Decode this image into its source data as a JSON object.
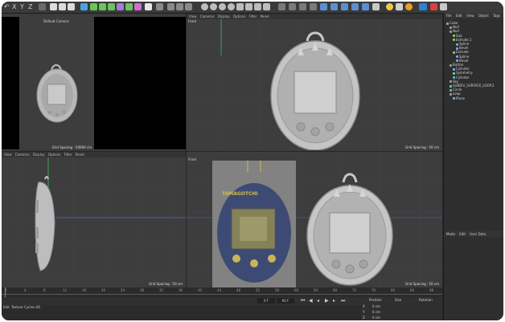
{
  "toolbar": {
    "menu_glyphs": [
      "X",
      "Y",
      "Z"
    ],
    "accent_color": "#e8a21d"
  },
  "viewports": {
    "top_left": {
      "name": "Default Camera",
      "grid": "Grid Spacing : 50000 cm"
    },
    "top_right": {
      "name": "Front",
      "grid": "Grid Spacing : 50 cm",
      "menu": [
        "View",
        "Cameras",
        "Display",
        "Options",
        "Filter",
        "Panel"
      ]
    },
    "bottom_left": {
      "name": "",
      "grid": "Grid Spacing : 50 cm",
      "menu": [
        "View",
        "Cameras",
        "Display",
        "Options",
        "Filter",
        "Panel"
      ]
    },
    "bottom_right": {
      "name": "Front",
      "grid": "Grid Spacing : 50 cm"
    }
  },
  "reference_image": {
    "brand_text": "TAMAGOTCHI"
  },
  "timeline": {
    "ticks": [
      "0",
      "4",
      "8",
      "12",
      "16",
      "20",
      "24",
      "28",
      "32",
      "36",
      "40",
      "44",
      "48",
      "52",
      "56",
      "60",
      "64",
      "68",
      "72",
      "76",
      "80",
      "84",
      "88"
    ],
    "current_frame": "0 F",
    "end_frame": "90 F"
  },
  "bottom_tabs": [
    "Edit",
    "Texture",
    "Cycles 4D"
  ],
  "object_manager": {
    "menu": [
      "File",
      "Edit",
      "View",
      "Object",
      "Tags"
    ],
    "rows": [
      {
        "label": "Cube",
        "indent": 0,
        "icon_color": "#5fb4e8"
      },
      {
        "label": "Null",
        "indent": 1,
        "icon_color": "#9a9a9a"
      },
      {
        "label": "Null",
        "indent": 1,
        "icon_color": "#9a9a9a"
      },
      {
        "label": "Sub",
        "indent": 2,
        "icon_color": "#7bd36b"
      },
      {
        "label": "Extrude.1",
        "indent": 2,
        "icon_color": "#7bd36b"
      },
      {
        "label": "Spline",
        "indent": 3,
        "icon_color": "#5fb4e8"
      },
      {
        "label": "Bevel",
        "indent": 3,
        "icon_color": "#8a9dd8"
      },
      {
        "label": "Extrude",
        "indent": 2,
        "icon_color": "#7bd36b"
      },
      {
        "label": "Spline",
        "indent": 3,
        "icon_color": "#5fb4e8"
      },
      {
        "label": "Bevel",
        "indent": 3,
        "icon_color": "#8a9dd8"
      },
      {
        "label": "Button",
        "indent": 1,
        "icon_color": "#9a9a9a"
      },
      {
        "label": "Cylinder",
        "indent": 2,
        "icon_color": "#5fb4e8"
      },
      {
        "label": "Symmetry",
        "indent": 2,
        "icon_color": "#7bd36b"
      },
      {
        "label": "Cylinder",
        "indent": 2,
        "icon_color": "#5fb4e8"
      },
      {
        "label": "Sky",
        "indent": 1,
        "icon_color": "#9a9a9a"
      },
      {
        "label": "SUBDIV_SURFACE_LOOP.2",
        "indent": 1,
        "icon_color": "#7bd36b"
      },
      {
        "label": "Circle",
        "indent": 1,
        "icon_color": "#5fb4e8"
      },
      {
        "label": "Loop",
        "indent": 1,
        "icon_color": "#9a9a9a"
      },
      {
        "label": "Plane",
        "indent": 2,
        "icon_color": "#5fb4e8"
      }
    ]
  },
  "attribute_manager": {
    "menu": [
      "Mode",
      "Edit",
      "User Data"
    ]
  },
  "coordinates": {
    "headers": [
      "Position",
      "Size",
      "Rotation"
    ],
    "axes": [
      "X",
      "Y",
      "Z"
    ],
    "value": "0 cm"
  }
}
